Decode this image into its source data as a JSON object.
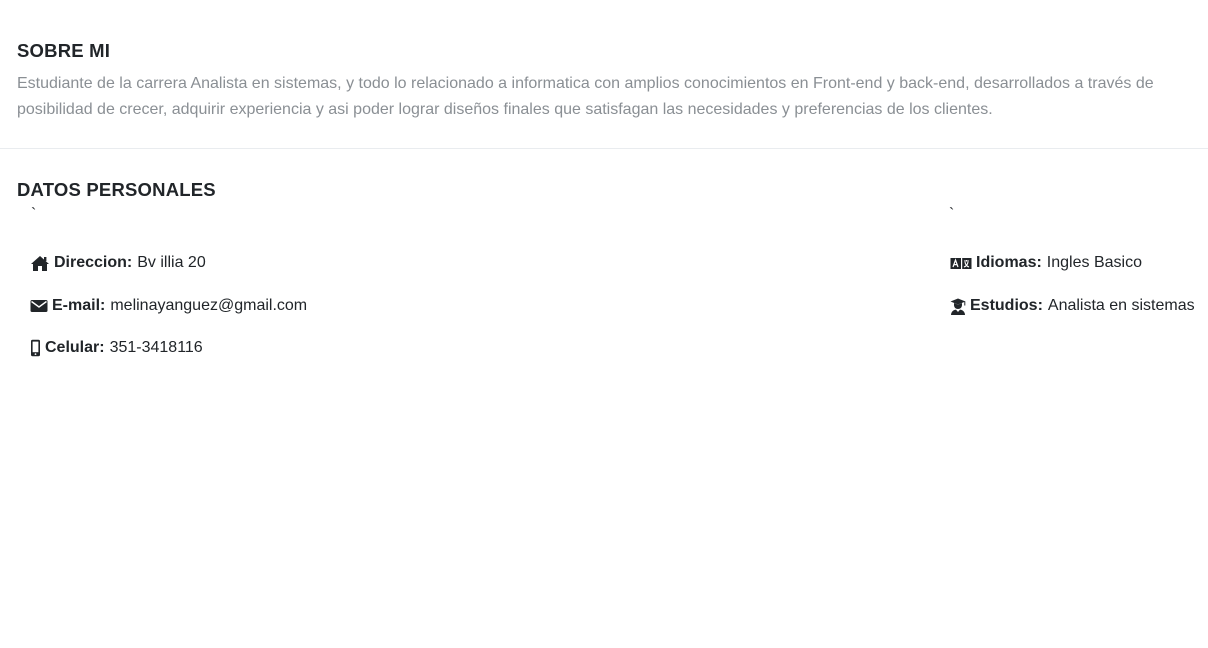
{
  "about": {
    "title": "SOBRE MI",
    "line1": "Estudiante de la carrera Analista en sistemas, y todo lo relacionado a informatica con amplios conocimientos en Front-end y back-end, desarrollados a través de",
    "line2": "posibilidad de crecer, adquirir experiencia y asi poder lograr diseños finales que satisfagan las necesidades y preferencias de los clientes."
  },
  "personal": {
    "title": "DATOS PERSONALES",
    "tick_left": "`",
    "tick_right": "`",
    "left": [
      {
        "icon": "home-icon",
        "label": "Direccion:",
        "value": "Bv illia 20"
      },
      {
        "icon": "envelope-icon",
        "label": "E-mail:",
        "value": "melinayanguez@gmail.com"
      },
      {
        "icon": "mobile-phone-icon",
        "label": "Celular:",
        "value": "351-3418116"
      }
    ],
    "right": [
      {
        "icon": "language-icon",
        "label": "Idiomas:",
        "value": "Ingles Basico"
      },
      {
        "icon": "graduate-icon",
        "label": "Estudios:",
        "value": "Analista en sistemas"
      }
    ]
  },
  "colors": {
    "text": "#212529",
    "muted_text": "#8a8f94",
    "divider": "#e9ecef",
    "background": "#ffffff"
  }
}
